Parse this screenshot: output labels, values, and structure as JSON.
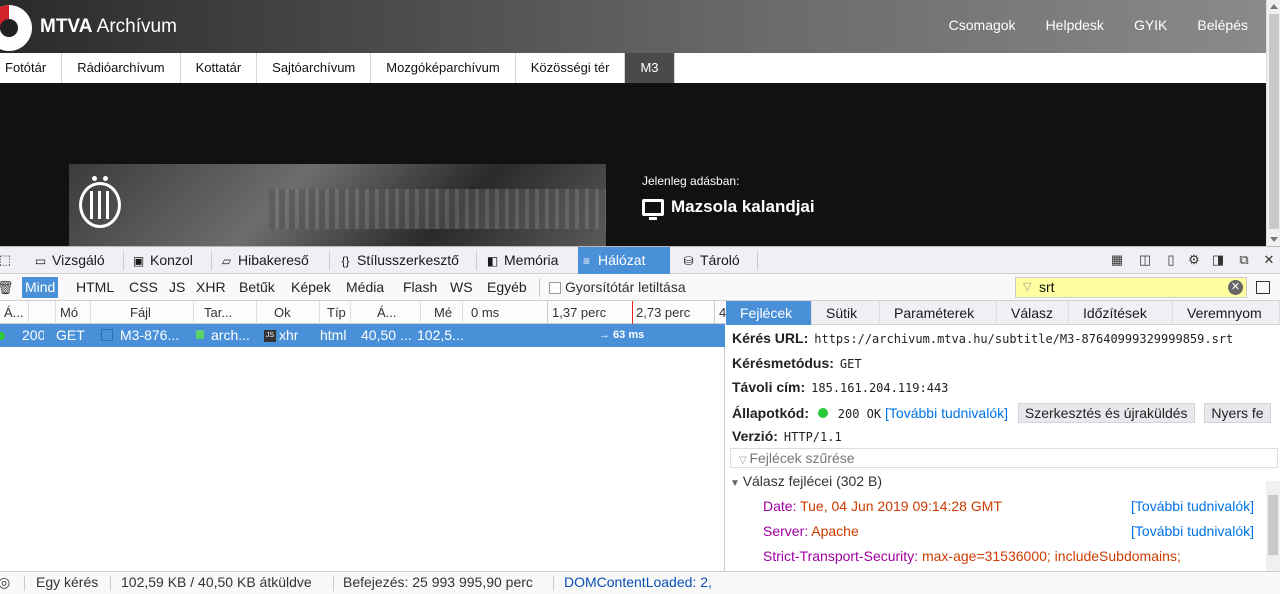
{
  "site": {
    "logo_bold": "MTVA",
    "logo_rest": " Archívum",
    "top_nav": [
      "Csomagok",
      "Helpdesk",
      "GYIK",
      "Belépés"
    ],
    "categories": [
      "Fotótár",
      "Rádióarchívum",
      "Kottatár",
      "Sajtóarchívum",
      "Mozgóképarchívum",
      "Közösségi tér",
      "M3"
    ],
    "active_category": "M3",
    "now_label": "Jelenleg adásban:",
    "now_title": "Mazsola kalandjai"
  },
  "devtools": {
    "tabs": [
      {
        "label": "Vizsgáló",
        "icon": "inspector-icon"
      },
      {
        "label": "Konzol",
        "icon": "console-icon"
      },
      {
        "label": "Hibakereső",
        "icon": "debugger-icon"
      },
      {
        "label": "Stílusszerkesztő",
        "icon": "style-editor-icon"
      },
      {
        "label": "Memória",
        "icon": "memory-icon"
      },
      {
        "label": "Hálózat",
        "icon": "network-icon"
      },
      {
        "label": "Tároló",
        "icon": "storage-icon"
      }
    ],
    "active_tab": "Hálózat",
    "filter_types": [
      "Mind",
      "HTML",
      "CSS",
      "JS",
      "XHR",
      "Betűk",
      "Képek",
      "Média",
      "Flash",
      "WS",
      "Egyéb"
    ],
    "active_filter": "Mind",
    "disable_cache_label": "Gyorsítótár letiltása",
    "filter_value": "srt",
    "columns": [
      "Á...",
      "Mó",
      "Fájl",
      "Tar...",
      "Ok",
      "Típ",
      "Á...",
      "Mé"
    ],
    "waterfall_ticks": [
      "0 ms",
      "1,37 perc",
      "2,73 perc",
      "4"
    ],
    "request": {
      "status": "200",
      "method": "GET",
      "file": "M3-876...",
      "domain": "arch...",
      "cause": "xhr",
      "type": "html",
      "transferred": "40,50 ...",
      "size": "102,5...",
      "timing": "→ 63 ms"
    },
    "details": {
      "tabs": [
        "Fejlécek",
        "Sütik",
        "Paraméterek",
        "Válasz",
        "Időzítések",
        "Veremnyom"
      ],
      "active_tab": "Fejlécek",
      "url_label": "Kérés URL:",
      "url": "https://archivum.mtva.hu/subtitle/M3-87640999329999859.srt",
      "method_label": "Kérésmetódus:",
      "method": "GET",
      "remote_label": "Távoli cím:",
      "remote": "185.161.204.119:443",
      "status_label": "Állapotkód:",
      "status_code": "200 OK",
      "more_info": "[További tudnivalók]",
      "edit_resend": "Szerkesztés és újraküldés",
      "raw": "Nyers fe",
      "version_label": "Verzió:",
      "version": "HTTP/1.1",
      "filter_placeholder": "Fejlécek szűrése",
      "response_headers": "Válasz fejlécei (302 B)",
      "headers": [
        {
          "name": "Date:",
          "value": "Tue, 04 Jun 2019 09:14:28 GMT"
        },
        {
          "name": "Server:",
          "value": "Apache"
        },
        {
          "name": "Strict-Transport-Security:",
          "value": "max-age=31536000; includeSubdomains;"
        }
      ],
      "more_info_link": "[További tudnivalók]"
    },
    "status_bar": {
      "requests": "Egy kérés",
      "transferred": "102,59 KB / 40,50 KB átküldve",
      "finish": "Befejezés: 25 993 995,90 perc",
      "dcl": "DOMContentLoaded: 2,"
    }
  }
}
